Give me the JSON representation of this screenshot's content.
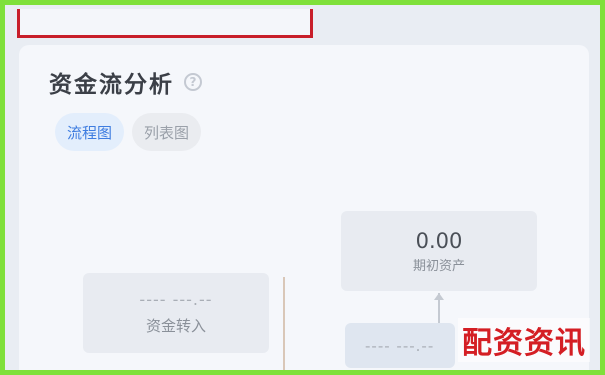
{
  "panel": {
    "title": "资金流分析",
    "tabs": [
      {
        "label": "流程图",
        "active": true
      },
      {
        "label": "列表图",
        "active": false
      }
    ]
  },
  "nodes": {
    "right": {
      "amount": "0.00",
      "label": "期初资产"
    },
    "left": {
      "amount": "----  ---.--",
      "label": "资金转入"
    },
    "bottom": {
      "amount": "----  ---.--"
    }
  },
  "watermark": "配资资讯",
  "colors": {
    "frame": "#7fe03a",
    "highlight_border": "#c81e2a",
    "tab_active_text": "#3f7de0",
    "watermark": "#d41e24"
  }
}
